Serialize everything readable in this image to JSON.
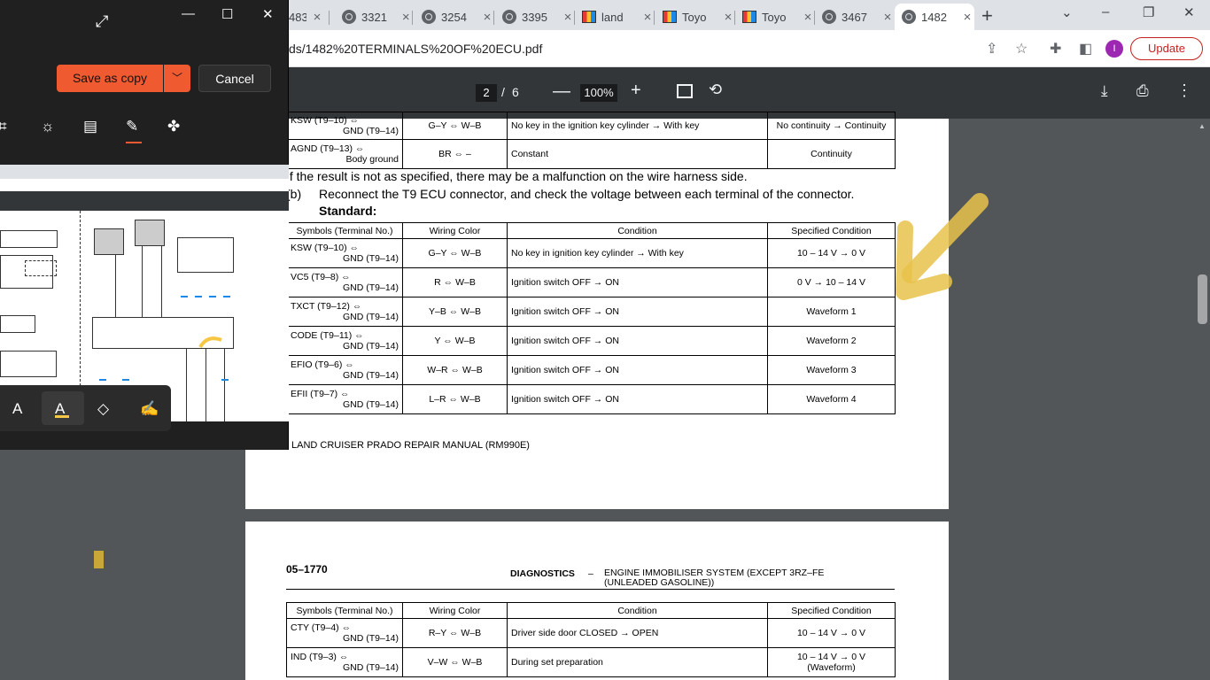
{
  "browser": {
    "tabs": [
      {
        "title": "483",
        "icon": "globe-icon"
      },
      {
        "title": "3321",
        "icon": "globe-icon"
      },
      {
        "title": "3254",
        "icon": "globe-icon"
      },
      {
        "title": "3395",
        "icon": "globe-icon"
      },
      {
        "title": "land",
        "icon": "toyota-favicon-icon"
      },
      {
        "title": "Toyo",
        "icon": "toyota-favicon-icon"
      },
      {
        "title": "Toyo",
        "icon": "toyota-favicon-icon"
      },
      {
        "title": "3467",
        "icon": "globe-icon"
      },
      {
        "title": "1482",
        "icon": "globe-icon",
        "active": true
      }
    ],
    "close_glyph": "×",
    "url": "ds/1482%20TERMINALS%20OF%20ECU.pdf",
    "avatar_letter": "I",
    "update_label": "Update"
  },
  "pdf_toolbar": {
    "current_page": "2",
    "separator": "/",
    "total_pages": "6",
    "zoom": "100%"
  },
  "editor": {
    "save_label": "Save as copy",
    "cancel_label": "Cancel"
  },
  "page1": {
    "top_rows": [
      {
        "sym1": "KSW (T9–10) ⇔",
        "sym2": "GND (T9–14)",
        "wire": "G–Y ⇔ W–B",
        "condition": "No key in the ignition key cylinder → With key",
        "spec": "No continuity → Continuity"
      },
      {
        "sym1": "AGND (T9–13) ⇔",
        "sym2": "Body ground",
        "wire": "BR ⇔ –",
        "condition": "Constant",
        "spec": "Continuity"
      }
    ],
    "note1": "If the result is not as specified, there may be a malfunction on the wire harness side.",
    "step_label": "(b)",
    "step_text": "Reconnect the T9 ECU connector, and check the voltage between each terminal of the connector.",
    "standard_label": "Standard:",
    "headers": [
      "Symbols (Terminal No.)",
      "Wiring Color",
      "Condition",
      "Specified Condition"
    ],
    "rows": [
      {
        "sym1": "KSW (T9–10) ⇔",
        "sym2": "GND (T9–14)",
        "wire": "G–Y ⇔ W–B",
        "condition": "No key in ignition key cylinder → With key",
        "spec": "10 – 14 V → 0 V"
      },
      {
        "sym1": "VC5 (T9–8) ⇔",
        "sym2": "GND (T9–14)",
        "wire": "R ⇔ W–B",
        "condition": "Ignition switch OFF → ON",
        "spec": "0 V → 10 – 14 V"
      },
      {
        "sym1": "TXCT (T9–12) ⇔",
        "sym2": "GND (T9–14)",
        "wire": "Y–B ⇔ W–B",
        "condition": "Ignition switch OFF → ON",
        "spec": "Waveform 1"
      },
      {
        "sym1": "CODE (T9–11) ⇔",
        "sym2": "GND (T9–14)",
        "wire": "Y ⇔ W–B",
        "condition": "Ignition switch OFF → ON",
        "spec": "Waveform 2"
      },
      {
        "sym1": "EFIO (T9–6) ⇔",
        "sym2": "GND (T9–14)",
        "wire": "W–R ⇔ W–B",
        "condition": "Ignition switch OFF → ON",
        "spec": "Waveform 3"
      },
      {
        "sym1": "EFII (T9–7) ⇔",
        "sym2": "GND (T9–14)",
        "wire": "L–R ⇔ W–B",
        "condition": "Ignition switch OFF → ON",
        "spec": "Waveform 4"
      }
    ],
    "footer": "LAND CRUISER PRADO REPAIR MANUAL   (RM990E)"
  },
  "page2": {
    "page_number": "05–1770",
    "section": "DIAGNOSTICS",
    "dash": "–",
    "title_line1": "ENGINE IMMOBILISER SYSTEM (EXCEPT 3RZ–FE",
    "title_line2": "(UNLEADED GASOLINE))",
    "headers": [
      "Symbols (Terminal No.)",
      "Wiring Color",
      "Condition",
      "Specified Condition"
    ],
    "rows": [
      {
        "sym1": "CTY (T9–4) ⇔",
        "sym2": "GND (T9–14)",
        "wire": "R–Y ⇔ W–B",
        "condition": "Driver side door CLOSED → OPEN",
        "spec": "10 – 14 V → 0 V",
        "spec2": ""
      },
      {
        "sym1": "IND (T9–3) ⇔",
        "sym2": "GND (T9–14)",
        "wire": "V–W ⇔ W–B",
        "condition": "During set preparation",
        "spec": "10 – 14 V → 0 V",
        "spec2": "(Waveform)"
      }
    ]
  },
  "colors": {
    "accent_orange": "#f05a30",
    "annotation_yellow": "#e8c24a",
    "pdf_toolbar": "#323639"
  }
}
